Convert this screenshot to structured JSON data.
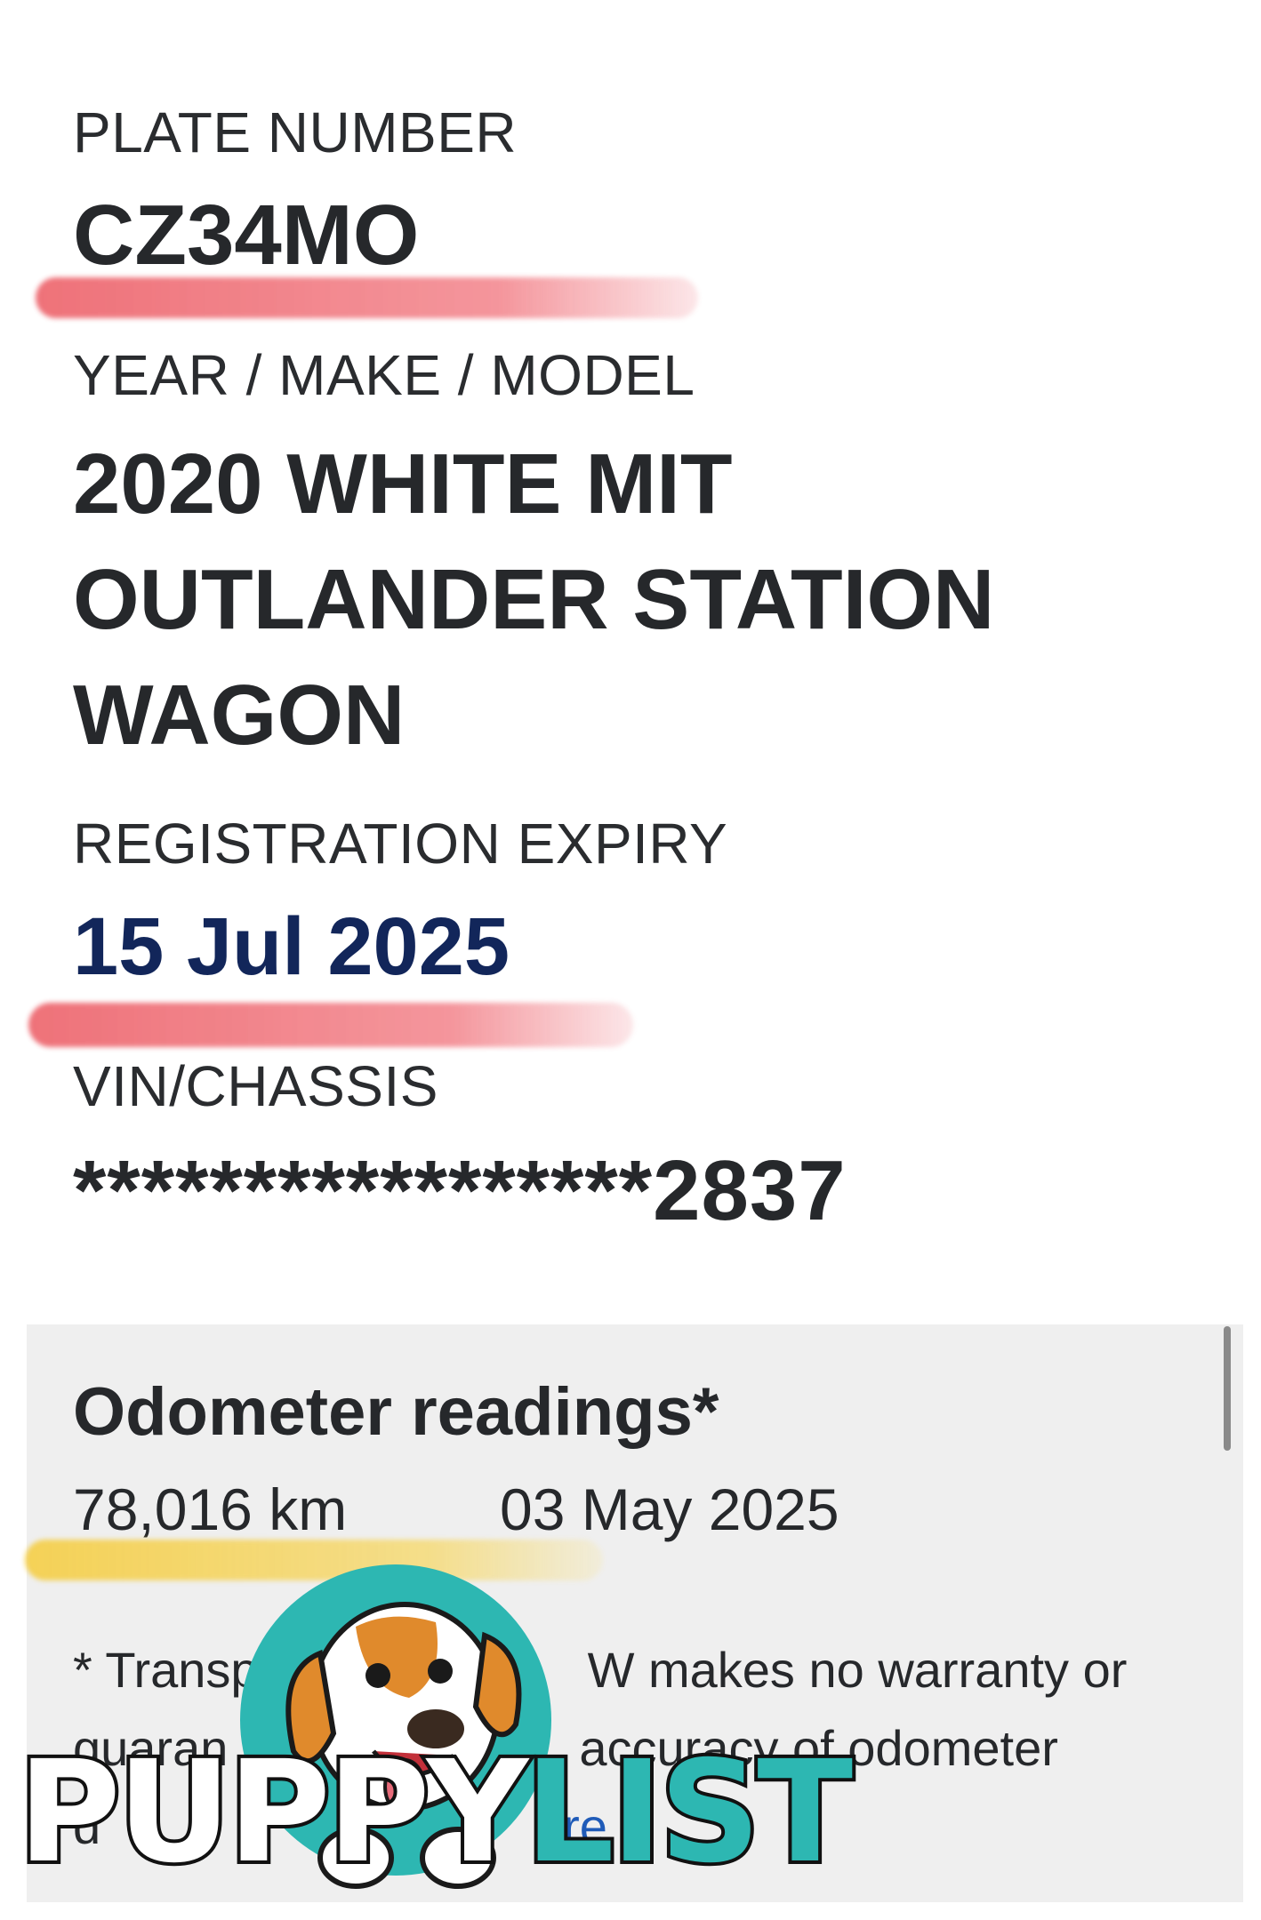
{
  "plate": {
    "label": "PLATE NUMBER",
    "value": "CZ34MO"
  },
  "vehicle": {
    "label": "YEAR / MAKE / MODEL",
    "lines": [
      "2020 WHITE MIT",
      "OUTLANDER STATION",
      "WAGON"
    ]
  },
  "registration": {
    "label": "REGISTRATION EXPIRY",
    "value": "15 Jul 2025"
  },
  "vin": {
    "label": "VIN/CHASSIS",
    "masked": "*****************",
    "suffix": "2837"
  },
  "odometer": {
    "title": "Odometer readings*",
    "reading": "78,016 km",
    "date": "03 May 2025",
    "disclaimer_visible_1": "* Transp",
    "disclaimer_visible_2": "W makes no warranty or",
    "disclaimer_visible_3": "guaran",
    "disclaimer_visible_4": "accuracy of odometer",
    "disclaimer_visible_5": "d",
    "more_link": "re"
  },
  "watermark": {
    "text_left": "PUPPY",
    "text_right": "LIST"
  },
  "colors": {
    "expiry_text": "#12265a",
    "highlight_red": "#e83c46",
    "highlight_yellow": "#f6c828",
    "brand_teal": "#2db7b2"
  }
}
